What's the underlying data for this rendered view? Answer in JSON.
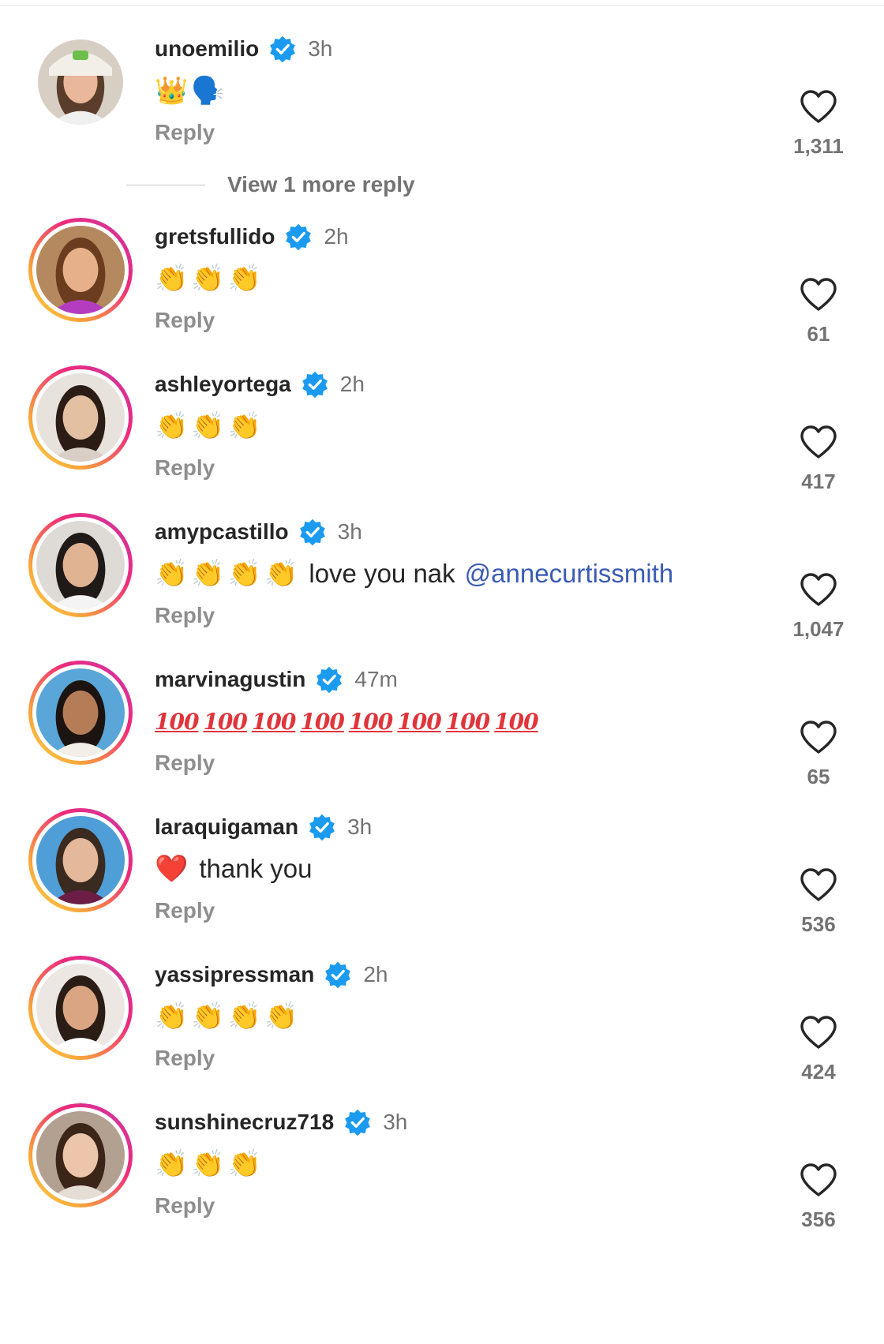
{
  "comments": [
    {
      "username": "unoemilio",
      "time": "3h",
      "emojis": [
        "👑",
        "🗣️"
      ],
      "text": "",
      "mention": "",
      "reply_label": "Reply",
      "likes": "1,311",
      "has_story_ring": false
    },
    {
      "username": "gretsfullido",
      "time": "2h",
      "emojis": [
        "👏",
        "👏",
        "👏"
      ],
      "text": "",
      "mention": "",
      "reply_label": "Reply",
      "likes": "61",
      "has_story_ring": true
    },
    {
      "username": "ashleyortega",
      "time": "2h",
      "emojis": [
        "👏",
        "👏",
        "👏"
      ],
      "text": "",
      "mention": "",
      "reply_label": "Reply",
      "likes": "417",
      "has_story_ring": true
    },
    {
      "username": "amypcastillo",
      "time": "3h",
      "emojis": [
        "👏",
        "👏",
        "👏",
        "👏"
      ],
      "text": "love you nak",
      "mention": "@annecurtissmith",
      "reply_label": "Reply",
      "likes": "1,047",
      "has_story_ring": true
    },
    {
      "username": "marvinagustin",
      "time": "47m",
      "emojis": [],
      "hundreds": [
        "100",
        "100",
        "100",
        "100",
        "100",
        "100",
        "100",
        "100"
      ],
      "text": "",
      "mention": "",
      "reply_label": "Reply",
      "likes": "65",
      "has_story_ring": true
    },
    {
      "username": "laraquigaman",
      "time": "3h",
      "emojis": [
        "❤️"
      ],
      "text": "thank you",
      "mention": "",
      "reply_label": "Reply",
      "likes": "536",
      "has_story_ring": true
    },
    {
      "username": "yassipressman",
      "time": "2h",
      "emojis": [
        "👏",
        "👏",
        "👏",
        "👏"
      ],
      "text": "",
      "mention": "",
      "reply_label": "Reply",
      "likes": "424",
      "has_story_ring": true
    },
    {
      "username": "sunshinecruz718",
      "time": "3h",
      "emojis": [
        "👏",
        "👏",
        "👏"
      ],
      "text": "",
      "mention": "",
      "reply_label": "Reply",
      "likes": "356",
      "has_story_ring": true
    }
  ],
  "view_more_replies": "View 1 more reply",
  "icons": {
    "verified": "verified-badge-icon",
    "like": "heart-outline-icon"
  },
  "colors": {
    "verified_blue": "#1a9bf0",
    "mention_blue": "#3b5bb5",
    "secondary_text": "#737373",
    "reply_text": "#8e8e8e"
  }
}
